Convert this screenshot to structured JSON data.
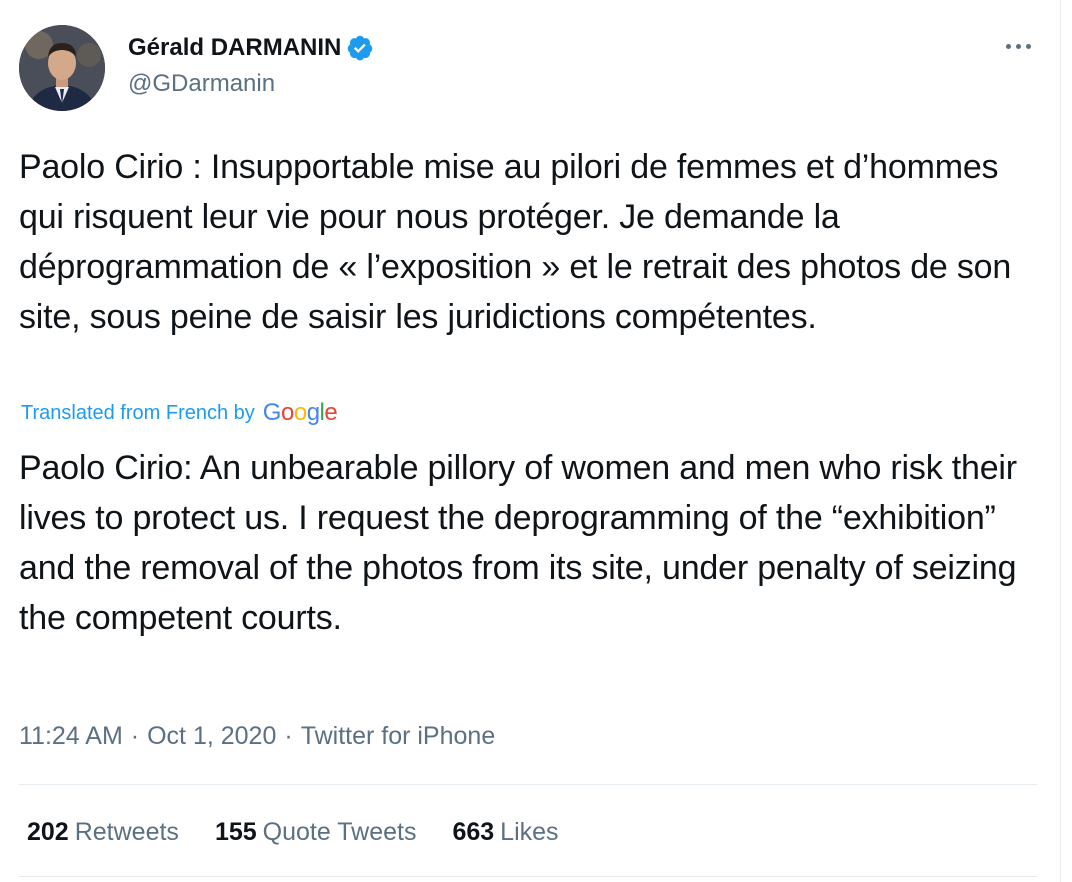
{
  "author": {
    "display_name": "Gérald DARMANIN",
    "handle": "@GDarmanin",
    "verified_icon": "verified-badge-icon"
  },
  "menu": {
    "icon": "more-options-icon"
  },
  "tweet": {
    "original_text": "Paolo Cirio : Insupportable mise au pilori de femmes et d’hommes qui risquent leur vie pour nous protéger. Je demande la déprogrammation de « l’exposition » et le retrait des photos de son site, sous peine de saisir les juridictions compétentes.",
    "translation_label": "Translated from French by",
    "translation_provider": "Google",
    "translated_text": "Paolo Cirio: An unbearable pillory of women and men who risk their lives to protect us. I request the deprogramming of the “exhibition” and the removal of the photos from its site, under penalty of seizing the competent courts.",
    "time": "11:24 AM",
    "date": "Oct 1, 2020",
    "separator": "·",
    "source": "Twitter for iPhone"
  },
  "stats": {
    "retweets": {
      "count": "202",
      "label": "Retweets"
    },
    "quotes": {
      "count": "155",
      "label": "Quote Tweets"
    },
    "likes": {
      "count": "663",
      "label": "Likes"
    }
  },
  "colors": {
    "link": "#1d9bf0",
    "secondary_text": "#5b7083",
    "primary_text": "#0f1419",
    "google_blue": "#4285F4",
    "google_red": "#EA4335",
    "google_yellow": "#FBBC05",
    "google_green": "#34A853"
  }
}
